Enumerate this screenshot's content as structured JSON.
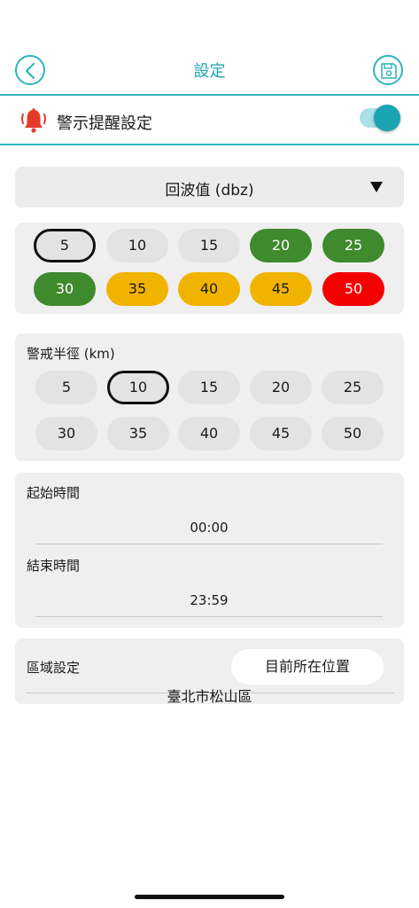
{
  "header": {
    "title": "設定",
    "back_icon": "chevron-left-icon",
    "save_icon": "floppy-disk-icon"
  },
  "alert": {
    "label": "警示提醒設定",
    "enabled": true,
    "icon": "bell-alert-icon"
  },
  "dropdown": {
    "label": "回波值 (dbz)"
  },
  "dbz": {
    "options": [
      "5",
      "10",
      "15",
      "20",
      "25",
      "30",
      "35",
      "40",
      "45",
      "50"
    ],
    "selected": "5"
  },
  "radius": {
    "label": "警戒半徑 (km)",
    "options": [
      "5",
      "10",
      "15",
      "20",
      "25",
      "30",
      "35",
      "40",
      "45",
      "50"
    ],
    "selected": "10"
  },
  "time": {
    "start_label": "起始時間",
    "start_value": "00:00",
    "end_label": "結束時間",
    "end_value": "23:59"
  },
  "region": {
    "label": "區域設定",
    "location_button": "目前所在位置",
    "name": "臺北市松山區"
  },
  "colors": {
    "accent": "#1fa6b3",
    "green": "#3f8a2d",
    "yellow": "#f0b400",
    "red": "#f50000"
  }
}
